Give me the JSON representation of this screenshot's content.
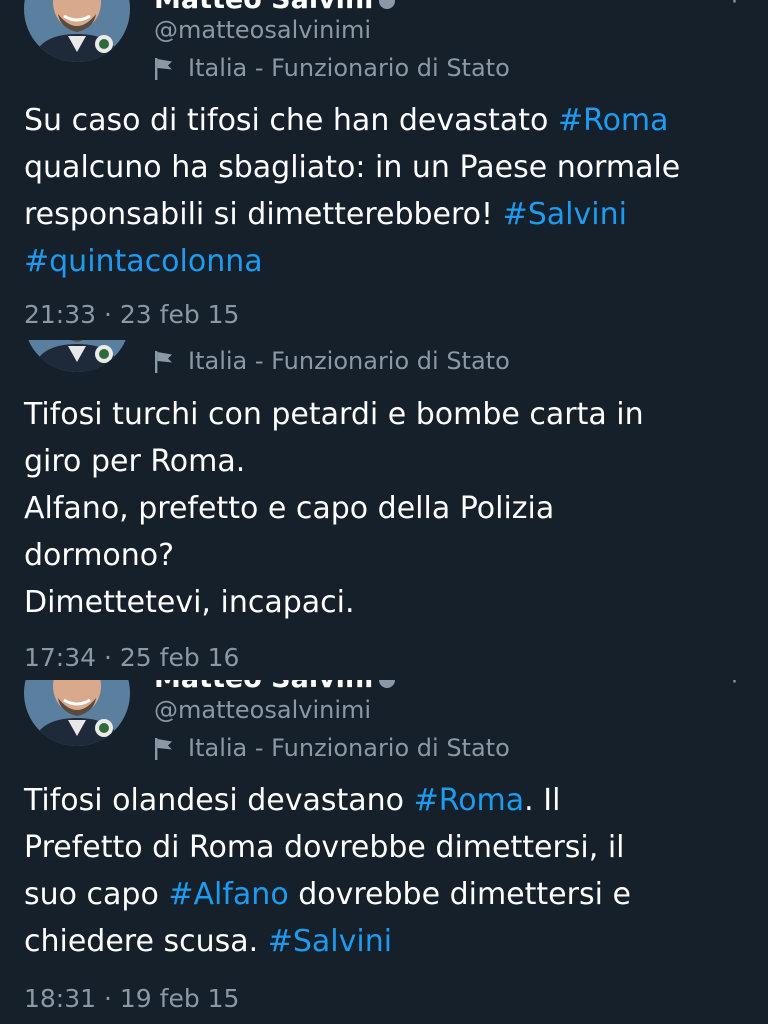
{
  "colors": {
    "background": "#15202b",
    "text": "#ffffff",
    "secondary_text": "#8b98a5",
    "link": "#1d9bf0"
  },
  "tweets": [
    {
      "display_name": "Matteo Salvini",
      "handle": "@matteosalvinimi",
      "account_label": "Italia - Funzionario di Stato",
      "timestamp": "21:33 · 23 feb 15",
      "text_lines": [
        [
          {
            "t": "Su caso di tifosi che han devastato "
          },
          {
            "t": "#Roma",
            "tag": true
          }
        ],
        [
          {
            "t": "qualcuno ha sbagliato: in un Paese normale"
          }
        ],
        [
          {
            "t": "responsabili si dimetterebbero! "
          },
          {
            "t": "#Salvini",
            "tag": true
          }
        ],
        [
          {
            "t": "#quintacolonna",
            "tag": true
          }
        ]
      ]
    },
    {
      "account_label": "Italia - Funzionario di Stato",
      "timestamp": "17:34 · 25 feb 16",
      "text_lines": [
        [
          {
            "t": "Tifosi turchi con petardi e bombe carta in"
          }
        ],
        [
          {
            "t": "giro per Roma."
          }
        ],
        [
          {
            "t": "Alfano, prefetto e capo della Polizia"
          }
        ],
        [
          {
            "t": "dormono?"
          }
        ],
        [
          {
            "t": "Dimettetevi, incapaci."
          }
        ]
      ]
    },
    {
      "display_name": "Matteo Salvini",
      "handle": "@matteosalvinimi",
      "account_label": "Italia - Funzionario di Stato",
      "timestamp": "18:31 · 19 feb 15",
      "text_lines": [
        [
          {
            "t": "Tifosi olandesi devastano "
          },
          {
            "t": "#Roma",
            "tag": true
          },
          {
            "t": ". Il"
          }
        ],
        [
          {
            "t": "Prefetto di Roma dovrebbe dimettersi, il"
          }
        ],
        [
          {
            "t": "suo capo "
          },
          {
            "t": "#Alfano",
            "tag": true
          },
          {
            "t": " dovrebbe dimettersi e"
          }
        ],
        [
          {
            "t": "chiedere scusa. "
          },
          {
            "t": "#Salvini",
            "tag": true
          }
        ]
      ]
    }
  ]
}
